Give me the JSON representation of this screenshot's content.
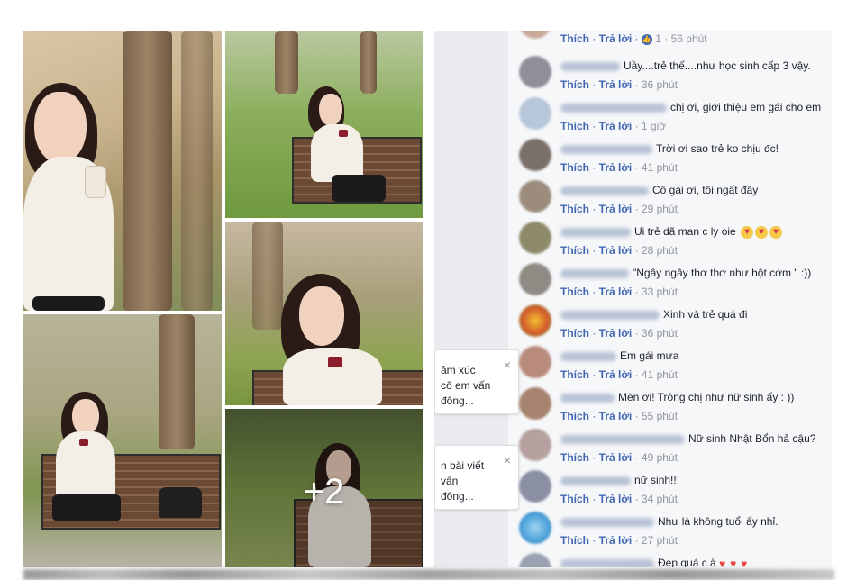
{
  "collage": {
    "photos": [
      {
        "name": "photo-1"
      },
      {
        "name": "photo-2"
      },
      {
        "name": "photo-3"
      },
      {
        "name": "photo-4"
      },
      {
        "name": "photo-5"
      }
    ],
    "more_count_label": "+2"
  },
  "comments": [
    {
      "text": "",
      "like_label": "Thích",
      "reply_label": "Trả lời",
      "reactions": "1",
      "time": "56 phút",
      "avatar_color": "#c9a99a"
    },
    {
      "text": "Uầy....trẻ thế....như học sinh cấp 3 vậy.",
      "like_label": "Thích",
      "reply_label": "Trả lời",
      "time": "36 phút",
      "avatar_color": "#8e8f98"
    },
    {
      "text": "chị ơi, giới thiệu em gái cho em",
      "like_label": "Thích",
      "reply_label": "Trả lời",
      "time": "1 giờ",
      "avatar_color": "#b7c7d9"
    },
    {
      "text": "Trời ơi sao trẻ ko chịu đc!",
      "like_label": "Thích",
      "reply_label": "Trả lời",
      "time": "41 phút",
      "avatar_color": "#7a6f69"
    },
    {
      "text": "Cô gái ơi, tôi ngất đây",
      "like_label": "Thích",
      "reply_label": "Trả lời",
      "time": "29 phút",
      "avatar_color": "#9b8c7c"
    },
    {
      "text": "Ui trẻ dã man c ly oie",
      "like_label": "Thích",
      "reply_label": "Trả lời",
      "time": "28 phút",
      "avatar_color": "#8d8a6a"
    },
    {
      "text": "\"Ngây ngây thơ thơ như hột cơm \" :))",
      "like_label": "Thích",
      "reply_label": "Trả lời",
      "time": "33 phút",
      "avatar_color": "#8f8a83"
    },
    {
      "text": "Xinh và trẻ quá đi",
      "like_label": "Thích",
      "reply_label": "Trả lời",
      "time": "36 phút",
      "avatar_color": "#d35a2a"
    },
    {
      "text": "Em gái mưa",
      "like_label": "Thích",
      "reply_label": "Trả lời",
      "time": "41 phút",
      "avatar_color": "#b98b7d"
    },
    {
      "text": "Mèn ơi! Trông chị như nữ sinh ấy : ))",
      "like_label": "Thích",
      "reply_label": "Trả lời",
      "time": "55 phút",
      "avatar_color": "#a6836e"
    },
    {
      "text": "Nữ sinh Nhật Bổn hả cậu?",
      "like_label": "Thích",
      "reply_label": "Trả lời",
      "time": "49 phút",
      "avatar_color": "#b6a0a0"
    },
    {
      "text": "nữ sinh!!!",
      "like_label": "Thích",
      "reply_label": "Trả lời",
      "time": "34 phút",
      "avatar_color": "#8a8fa4"
    },
    {
      "text": "Như là không tuổi ấy nhỉ.",
      "like_label": "Thích",
      "reply_label": "Trả lời",
      "time": "27 phút",
      "avatar_color": "#4aa0d8"
    },
    {
      "text": "Đẹp quá c à",
      "like_label": "",
      "reply_label": "",
      "time": "",
      "avatar_color": "#9aa2b2"
    }
  ],
  "notifications": [
    {
      "text": "ảm xúc\ncô em vấn\nđông...",
      "close_label": "×"
    },
    {
      "text": "n bài viết\nvấn\nđông...",
      "close_label": "×"
    }
  ],
  "reaction_icon": "like-icon",
  "emoji_icon": "kiss-emoji-icon",
  "heart_icon": "heart-eyes-emoji-icon",
  "colors": {
    "link": "#4267b2",
    "meta": "#90949c",
    "panel_bg": "#f6f7f9"
  }
}
